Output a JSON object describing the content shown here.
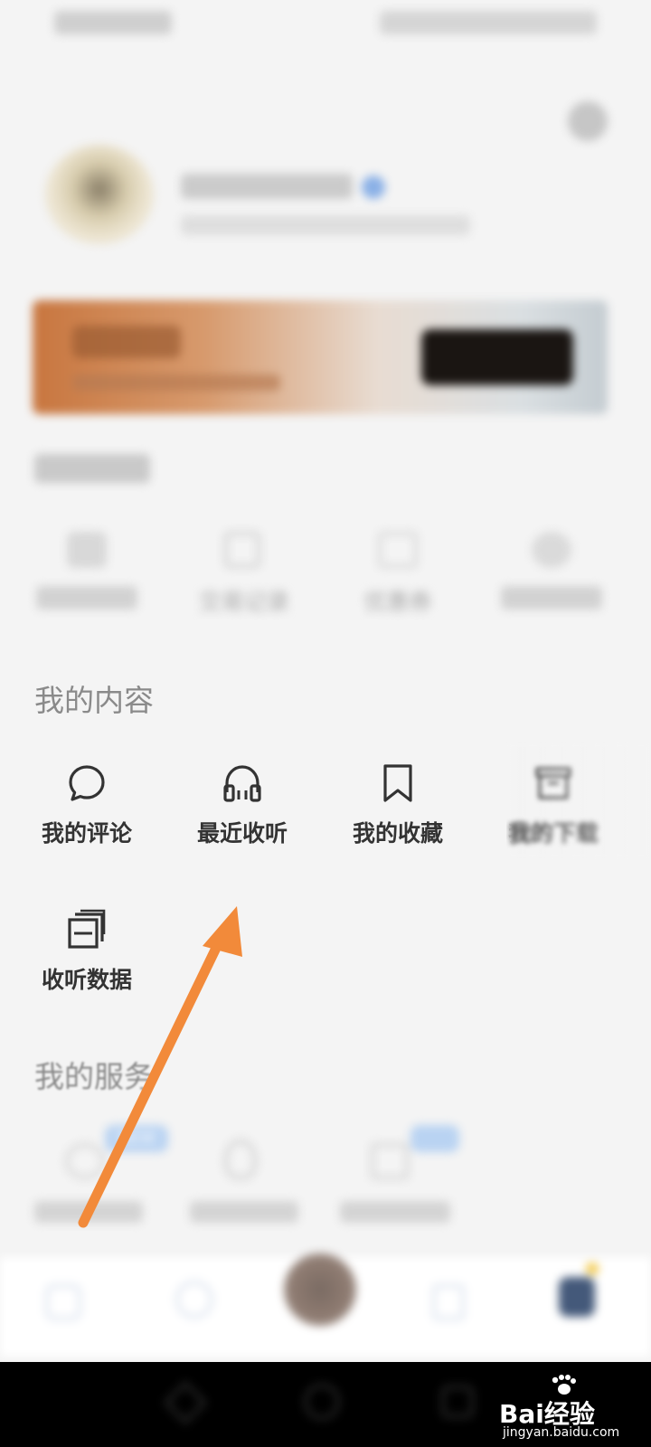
{
  "status_bar": {
    "left": "",
    "right": ""
  },
  "profile": {
    "name": "",
    "subtitle": ""
  },
  "vip_banner": {
    "title": "",
    "subtitle": "",
    "button_label": ""
  },
  "account_section": {
    "title": "",
    "items": [
      {
        "label": ""
      },
      {
        "label": "交易记录"
      },
      {
        "label": "优惠券"
      },
      {
        "label": ""
      }
    ]
  },
  "content_section": {
    "title": "我的内容",
    "items": [
      {
        "label": "我的评论",
        "icon": "comment-bubble-icon"
      },
      {
        "label": "最近收听",
        "icon": "headphones-icon"
      },
      {
        "label": "我的收藏",
        "icon": "bookmark-icon"
      },
      {
        "label": "我的下载",
        "icon": "download-box-icon"
      },
      {
        "label": "收听数据",
        "icon": "stacked-cards-icon"
      }
    ]
  },
  "service_section": {
    "title": "我的服务",
    "items": [
      {
        "label": "",
        "badge": "NEW"
      },
      {
        "label": ""
      },
      {
        "label": "",
        "badge": ""
      }
    ]
  },
  "bottom_nav": {
    "items": [
      {
        "label": ""
      },
      {
        "label": ""
      },
      {
        "label": ""
      },
      {
        "label": ""
      },
      {
        "label": ""
      }
    ]
  },
  "watermark": {
    "text": "Bai经验",
    "url": "jingyan.baidu.com"
  },
  "colors": {
    "arrow": "#f28a3a",
    "vip_start": "#c8763f",
    "vip_end": "#c9d1d6"
  }
}
